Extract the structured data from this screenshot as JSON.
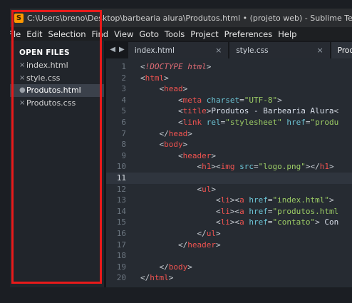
{
  "titlebar": {
    "icon": "sublime-logo-icon",
    "title": "C:\\Users\\breno\\Desktop\\barbearia alura\\Produtos.html • (projeto web) - Sublime Text (UNREGISTERED)"
  },
  "menubar": [
    "File",
    "Edit",
    "Selection",
    "Find",
    "View",
    "Goto",
    "Tools",
    "Project",
    "Preferences",
    "Help"
  ],
  "sidebar": {
    "heading": "OPEN FILES",
    "files": [
      {
        "name": "index.html",
        "marker": "×",
        "active": false
      },
      {
        "name": "style.css",
        "marker": "×",
        "active": false
      },
      {
        "name": "Produtos.html",
        "marker": "●",
        "active": true
      },
      {
        "name": "Produtos.css",
        "marker": "×",
        "active": false
      }
    ]
  },
  "tabs": [
    {
      "label": "index.html",
      "close": "×"
    },
    {
      "label": "style.css",
      "close": "×"
    },
    {
      "label": "Produtos.html",
      "close": ""
    }
  ],
  "tab_nav": {
    "prev": "◀",
    "next": "▶"
  },
  "editor": {
    "current_line": 11,
    "lines": [
      "1",
      "2",
      "3",
      "4",
      "5",
      "6",
      "7",
      "8",
      "9",
      "10",
      "11",
      "12",
      "13",
      "14",
      "15",
      "16",
      "17",
      "18",
      "19",
      "20"
    ]
  },
  "colors": {
    "highlight_box": "#e81a1a",
    "tag": "#ef5350",
    "attribute": "#6cc3d4",
    "string": "#9ccc65"
  }
}
